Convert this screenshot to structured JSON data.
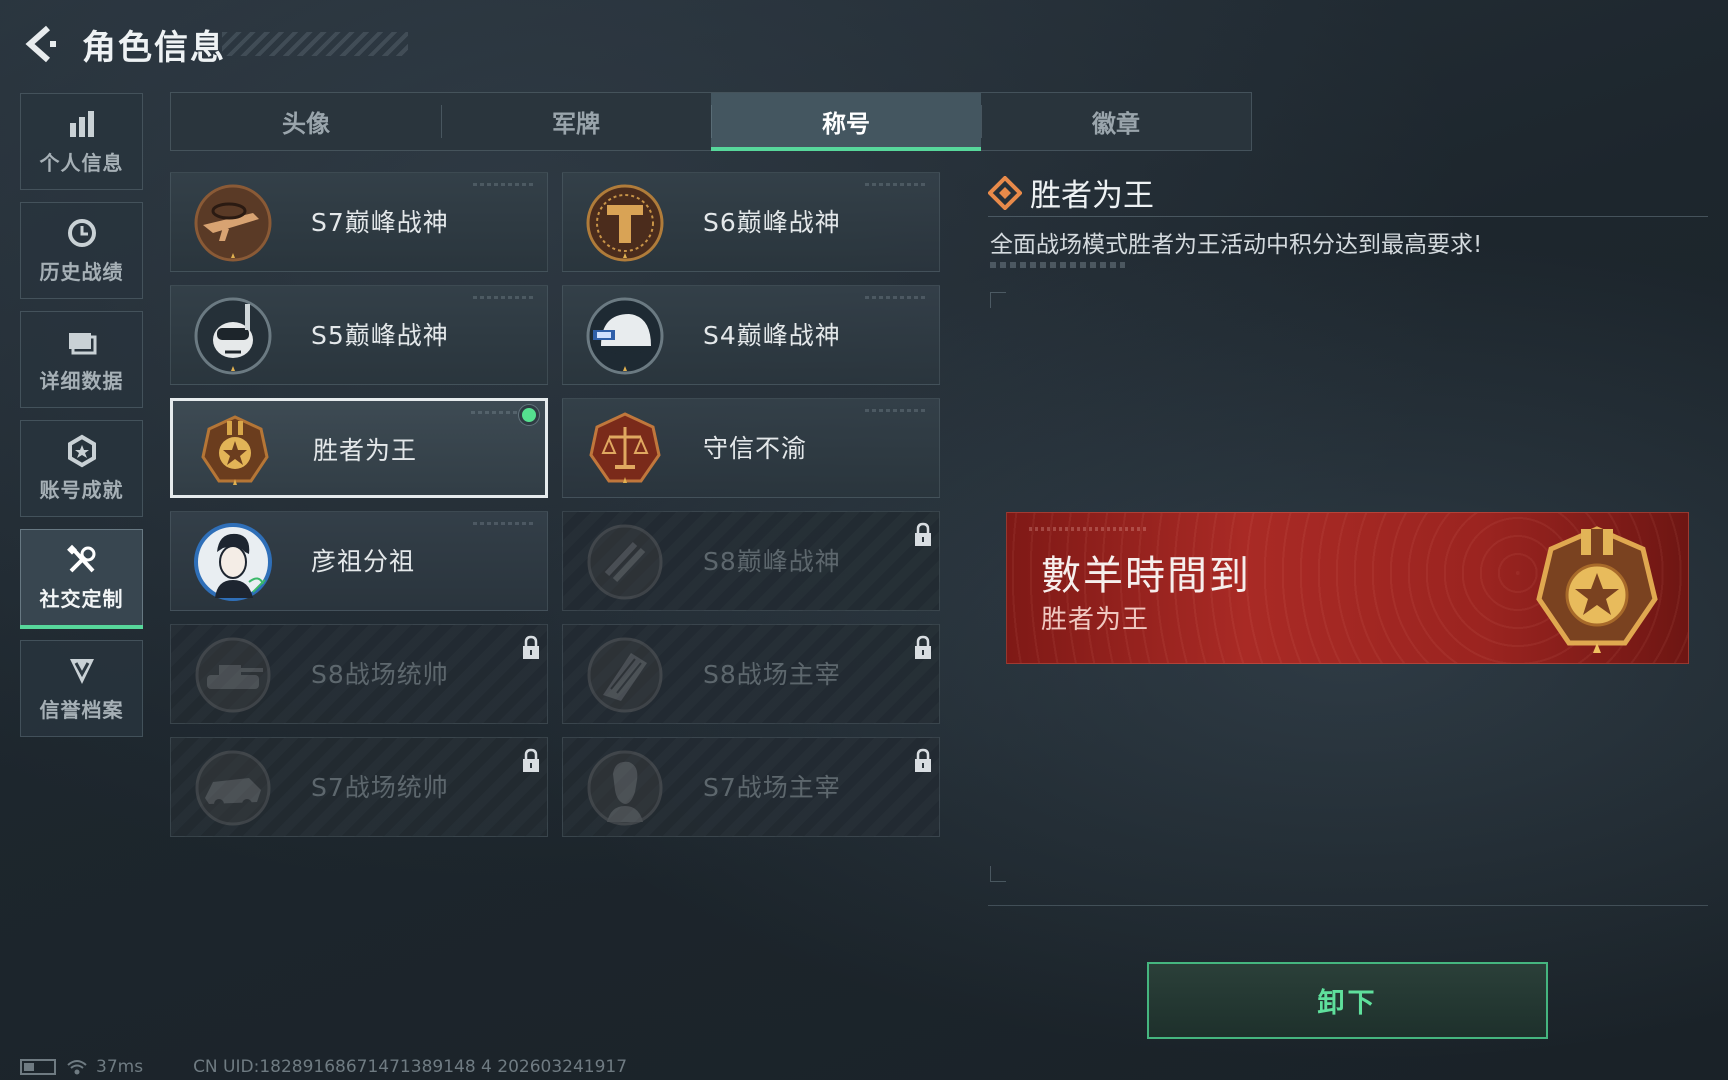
{
  "header": {
    "title": "角色信息"
  },
  "sidebar": {
    "items": [
      {
        "label": "个人信息",
        "icon": "bar-chart-icon",
        "active": false
      },
      {
        "label": "历史战绩",
        "icon": "history-clock-icon",
        "active": false
      },
      {
        "label": "详细数据",
        "icon": "folder-icon",
        "active": false
      },
      {
        "label": "账号成就",
        "icon": "achievement-badge-icon",
        "active": false
      },
      {
        "label": "社交定制",
        "icon": "wrench-tools-icon",
        "active": true
      },
      {
        "label": "信誉档案",
        "icon": "shield-chevron-icon",
        "active": false
      }
    ]
  },
  "tabs": [
    {
      "label": "头像",
      "active": false
    },
    {
      "label": "军牌",
      "active": false
    },
    {
      "label": "称号",
      "active": true
    },
    {
      "label": "徽章",
      "active": false
    }
  ],
  "titles": [
    {
      "name": "S7巅峰战神",
      "emblem": "rifle-emblem-icon",
      "locked": false
    },
    {
      "name": "S6巅峰战神",
      "emblem": "t-shield-emblem-icon",
      "locked": false
    },
    {
      "name": "S5巅峰战神",
      "emblem": "skull-diver-emblem-icon",
      "locked": false
    },
    {
      "name": "S4巅峰战神",
      "emblem": "helmet-emblem-icon",
      "locked": false
    },
    {
      "name": "胜者为王",
      "emblem": "gold-medal-emblem-icon",
      "locked": false,
      "selected": true
    },
    {
      "name": "守信不渝",
      "emblem": "scales-emblem-icon",
      "locked": false
    },
    {
      "name": "彦祖分祖",
      "emblem": "portrait-emblem-icon",
      "locked": false
    },
    {
      "name": "S8巅峰战神",
      "emblem": "slash-emblem-icon",
      "locked": true
    },
    {
      "name": "S8战场统帅",
      "emblem": "tank-emblem-icon",
      "locked": true
    },
    {
      "name": "S8战场主宰",
      "emblem": "building-emblem-icon",
      "locked": true
    },
    {
      "name": "S7战场统帅",
      "emblem": "vehicle-emblem-icon",
      "locked": true
    },
    {
      "name": "S7战场主宰",
      "emblem": "soldier-emblem-icon",
      "locked": true
    }
  ],
  "detail": {
    "title": "胜者为王",
    "description": "全面战场模式胜者为王活动中积分达到最高要求!"
  },
  "banner": {
    "player_name": "數羊時間到",
    "title": "胜者为王"
  },
  "actions": {
    "unequip_label": "卸下"
  },
  "footer": {
    "ping": "37ms",
    "uid": "CN UID:18289168671471389148 4 202603241917"
  },
  "colors": {
    "accent": "#57d79b",
    "banner": "#a92a25",
    "gold": "#d4a54a"
  }
}
